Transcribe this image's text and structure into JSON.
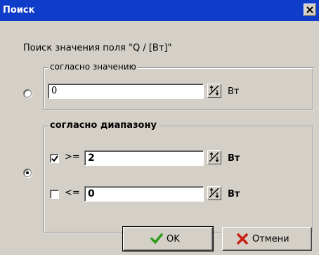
{
  "window": {
    "title": "Поиск"
  },
  "search": {
    "label": "Поиск значения поля \"Q / [Вт]\"",
    "by_value": {
      "legend": "согласно значению",
      "value": "0",
      "unit": "Вт",
      "selected": false
    },
    "by_range": {
      "legend": "согласно диапазону",
      "selected": true,
      "min": {
        "checked": true,
        "operator": ">=",
        "value": "2",
        "unit": "Вт"
      },
      "max": {
        "checked": false,
        "operator": "<=",
        "value": "0",
        "unit": "Вт"
      }
    }
  },
  "buttons": {
    "ok_label": "OK",
    "cancel_label": "Отмени"
  },
  "colors": {
    "titlebar": "#0f3cc8",
    "face": "#d4d0c8",
    "ok_check": "#2e9a1a",
    "cancel_x": "#c81e12"
  },
  "icons": [
    "close-icon",
    "spin-arrows-icon",
    "checkmark-icon",
    "cross-icon"
  ]
}
